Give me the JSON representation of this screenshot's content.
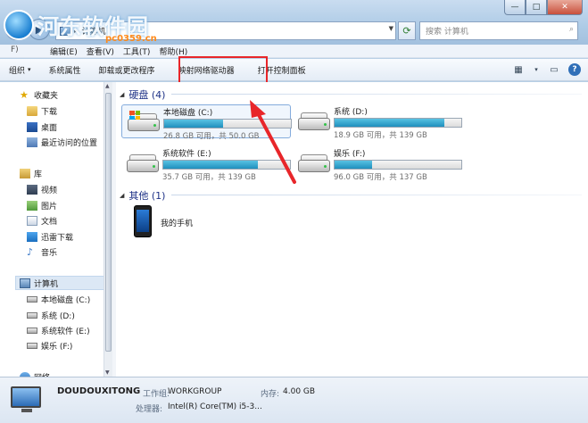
{
  "window": {
    "minimize_glyph": "—",
    "maximize_glyph": "□",
    "close_glyph": "✕"
  },
  "watermark": {
    "text": "河东软件园",
    "url": "pc0359.cn"
  },
  "address": {
    "segment": "计算机",
    "separator": "▸",
    "search_placeholder": "搜索 计算机"
  },
  "menubar": {
    "items": [
      "编辑(E)",
      "查看(V)",
      "工具(T)",
      "帮助(H)"
    ],
    "first_visible": "F)"
  },
  "toolbar": {
    "organize": "组织",
    "system_properties": "系统属性",
    "uninstall": "卸载或更改程序",
    "map_drive": "映射网络驱动器",
    "control_panel": "打开控制面板"
  },
  "nav": {
    "favorites": "收藏夹",
    "downloads": "下载",
    "desktop": "桌面",
    "recent": "最近访问的位置",
    "libraries": "库",
    "videos": "视频",
    "pictures": "图片",
    "documents": "文档",
    "thunder": "迅雷下载",
    "music": "音乐",
    "computer": "计算机",
    "drive_c": "本地磁盘 (C:)",
    "drive_d": "系统 (D:)",
    "drive_e": "系统软件 (E:)",
    "drive_f": "娱乐 (F:)",
    "network": "网络"
  },
  "groups": {
    "hard_disks": "硬盘 (4)",
    "other": "其他 (1)"
  },
  "drives": [
    {
      "name": "本地磁盘 (C:)",
      "free": "26.8 GB 可用，共 50.0 GB",
      "used_fraction": 0.464
    },
    {
      "name": "系统 (D:)",
      "free": "18.9 GB 可用，共 139 GB",
      "used_fraction": 0.864
    },
    {
      "name": "系统软件 (E:)",
      "free": "35.7 GB 可用，共 139 GB",
      "used_fraction": 0.743
    },
    {
      "name": "娱乐 (F:)",
      "free": "96.0 GB 可用，共 137 GB",
      "used_fraction": 0.299
    }
  ],
  "other_devices": [
    {
      "name": "我的手机"
    }
  ],
  "details": {
    "computer_name": "DOUDOUXITONG",
    "workgroup_label": "工作组:",
    "workgroup_value": "WORKGROUP",
    "memory_label": "内存:",
    "memory_value": "4.00 GB",
    "processor_label": "处理器:",
    "processor_value": "Intel(R) Core(TM) i5-3..."
  },
  "colors": {
    "highlight": "#e8262a",
    "drive_bar": "#1f8fbd",
    "group_header": "#1e3287"
  }
}
